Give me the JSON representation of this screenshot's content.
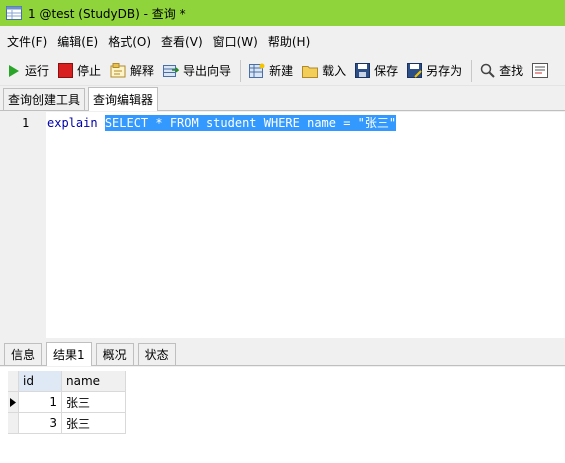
{
  "window": {
    "title": "1 @test (StudyDB) - 查询 *"
  },
  "menu": [
    "文件(F)",
    "编辑(E)",
    "格式(O)",
    "查看(V)",
    "窗口(W)",
    "帮助(H)"
  ],
  "toolbar": {
    "run": "运行",
    "stop": "停止",
    "explain": "解释",
    "export_wizard": "导出向导",
    "new": "新建",
    "load": "载入",
    "save": "保存",
    "save_as": "另存为",
    "find": "查找"
  },
  "editor_tabs": [
    "查询创建工具",
    "查询编辑器"
  ],
  "editor": {
    "line_number": "1",
    "keyword": "explain",
    "selected_sql": "SELECT * FROM student WHERE name = \"张三\""
  },
  "result_tabs": [
    "信息",
    "结果1",
    "概况",
    "状态"
  ],
  "results": {
    "columns": [
      "id",
      "name"
    ],
    "rows": [
      {
        "id": "1",
        "name": "张三"
      },
      {
        "id": "3",
        "name": "张三"
      }
    ]
  },
  "colors": {
    "titlebar": "#8fd43a",
    "selection": "#3399ff",
    "keyword": "#0000aa"
  }
}
